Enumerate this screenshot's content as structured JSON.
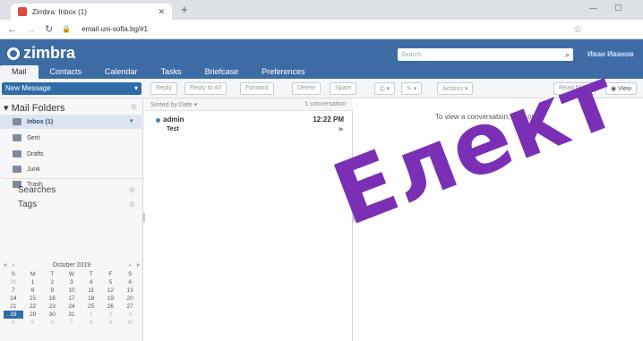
{
  "browser": {
    "tab_title": "Zimbra: Inbox (1)",
    "url": "email.uni-sofia.bg/#1"
  },
  "header": {
    "logo": "zimbra",
    "search_placeholder": "Search",
    "user_name": "Иван Иванов",
    "app_tabs": [
      "Mail",
      "Contacts",
      "Calendar",
      "Tasks",
      "Briefcase",
      "Preferences"
    ]
  },
  "toolbar": {
    "new_message": "New Message",
    "reply": "Reply",
    "reply_all": "Reply to All",
    "forward": "Forward",
    "delete": "Delete",
    "spam": "Spam",
    "actions": "Actions",
    "read_more": "Read More",
    "view": "View"
  },
  "sidebar": {
    "heading": "Mail Folders",
    "folders": [
      {
        "label": "Inbox (1)"
      },
      {
        "label": "Sent"
      },
      {
        "label": "Drafts"
      },
      {
        "label": "Junk"
      },
      {
        "label": "Trash"
      }
    ],
    "searches": "Searches",
    "tags": "Tags"
  },
  "calendar": {
    "month": "October 2019",
    "weekdays": [
      "S",
      "M",
      "T",
      "W",
      "T",
      "F",
      "S"
    ],
    "rows": [
      [
        "30",
        "1",
        "2",
        "3",
        "4",
        "5",
        "6"
      ],
      [
        "7",
        "8",
        "9",
        "10",
        "11",
        "12",
        "13"
      ],
      [
        "14",
        "15",
        "16",
        "17",
        "18",
        "19",
        "20"
      ],
      [
        "21",
        "22",
        "23",
        "24",
        "25",
        "26",
        "27"
      ],
      [
        "28",
        "29",
        "30",
        "31",
        "1",
        "2",
        "3"
      ],
      [
        "4",
        "5",
        "6",
        "7",
        "8",
        "9",
        "10"
      ]
    ]
  },
  "message_list": {
    "sort_label": "Sorted by Date",
    "count": "1 conversation",
    "messages": [
      {
        "from": "admin",
        "time": "12:22 PM",
        "subject": "Test"
      }
    ]
  },
  "reading_pane": {
    "hint": "To view a conversation, click on it."
  },
  "overlay_text": "Елект"
}
